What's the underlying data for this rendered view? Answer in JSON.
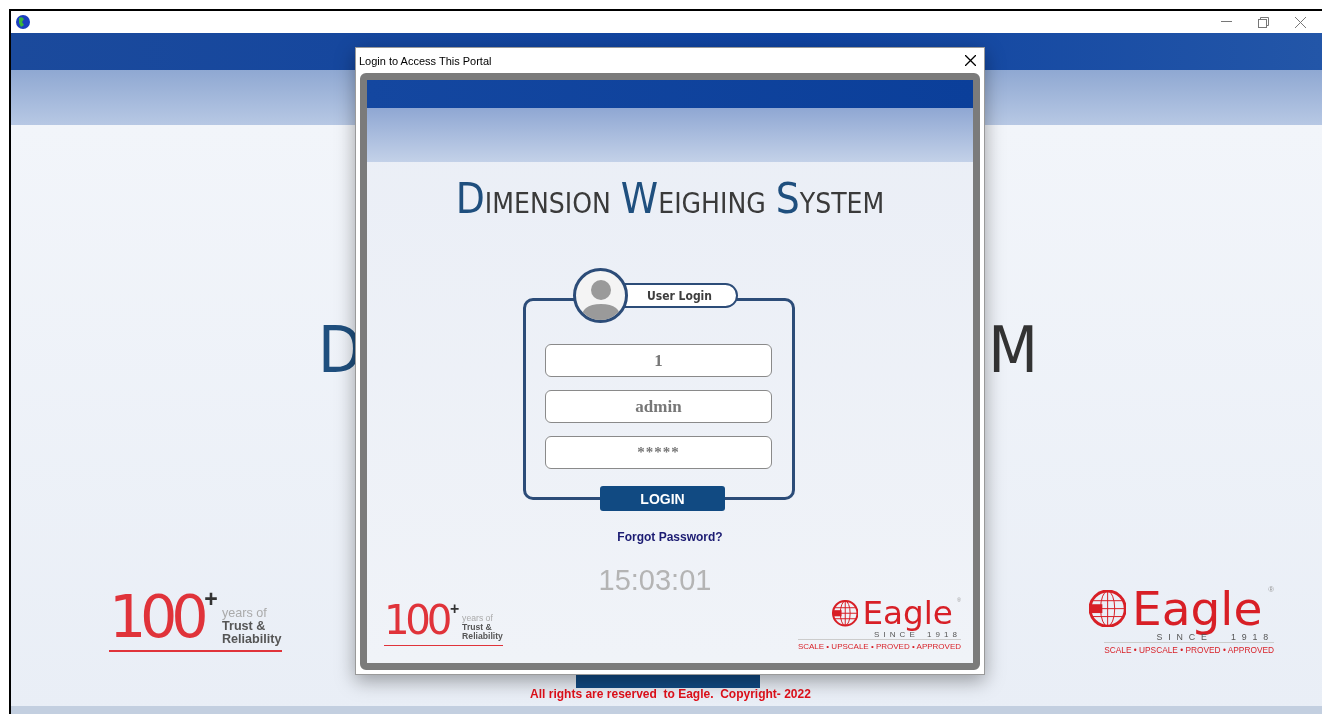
{
  "background": {
    "title_letters": [
      "D",
      "M"
    ],
    "left_logo": {
      "number": "100",
      "plus": "+",
      "lines": [
        "years of",
        "Trust &",
        "Reliability"
      ]
    },
    "right_logo": {
      "name": "Eagle",
      "registered": "®",
      "since": "SINCE",
      "year": "1918",
      "tagline": "SCALE • UPSCALE • PROVED • APPROVED"
    },
    "footer": "All rights are reserved  to Eagle.  Copyright- 2022"
  },
  "dialog": {
    "title": "Login to Access This Portal",
    "app_title": "DIMENSION WEIGHING SYSTEM",
    "login_card": {
      "heading": "User Login",
      "fields": [
        {
          "kind": "text",
          "value": "1"
        },
        {
          "kind": "text",
          "value": "admin"
        },
        {
          "kind": "password",
          "value": "*****"
        }
      ],
      "button": "LOGIN"
    },
    "forgot_link": "Forgot Password?",
    "clock": "15:03:01",
    "left_logo": {
      "number": "100",
      "plus": "+",
      "lines": [
        "years of",
        "Trust &",
        "Reliability"
      ]
    },
    "right_logo": {
      "name": "Eagle",
      "registered": "®",
      "since": "SINCE",
      "year": "1918",
      "tagline": "SCALE • UPSCALE • PROVED • APPROVED"
    }
  }
}
